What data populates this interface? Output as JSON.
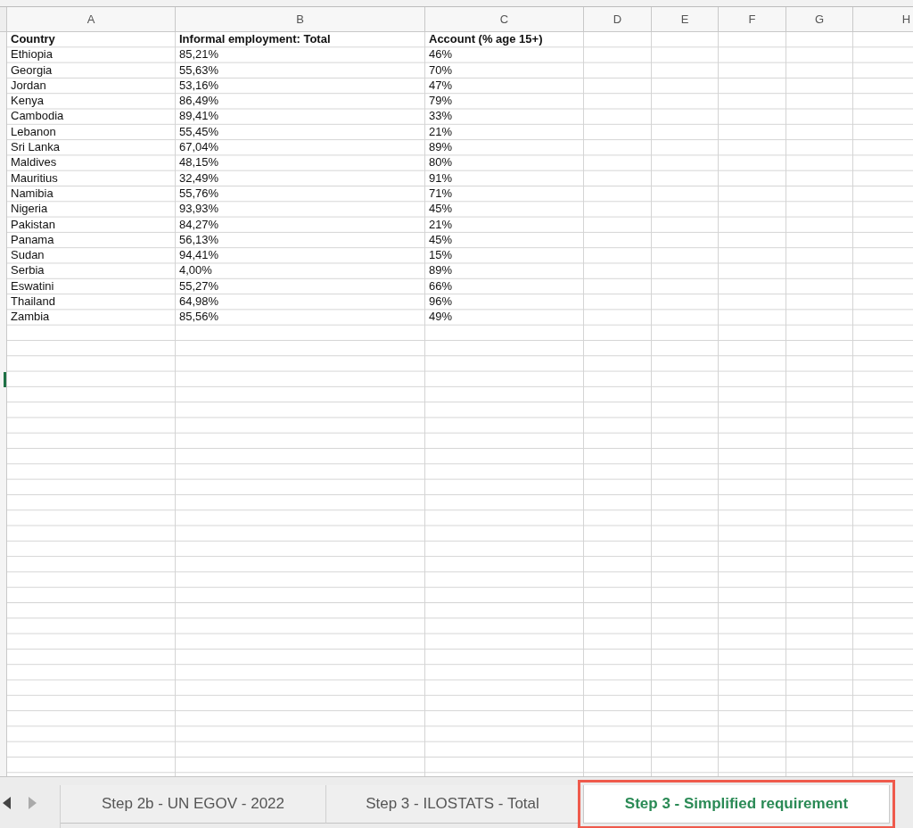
{
  "columns": [
    "A",
    "B",
    "C",
    "D",
    "E",
    "F",
    "G",
    "H"
  ],
  "header_row": [
    "Country",
    "Informal employment: Total",
    "Account (% age 15+)"
  ],
  "rows": [
    [
      "Ethiopia",
      "85,21%",
      "46%"
    ],
    [
      "Georgia",
      "55,63%",
      "70%"
    ],
    [
      "Jordan",
      "53,16%",
      "47%"
    ],
    [
      "Kenya",
      "86,49%",
      "79%"
    ],
    [
      "Cambodia",
      "89,41%",
      "33%"
    ],
    [
      "Lebanon",
      "55,45%",
      "21%"
    ],
    [
      "Sri Lanka",
      "67,04%",
      "89%"
    ],
    [
      "Maldives",
      "48,15%",
      "80%"
    ],
    [
      "Mauritius",
      "32,49%",
      "91%"
    ],
    [
      "Namibia",
      "55,76%",
      "71%"
    ],
    [
      "Nigeria",
      "93,93%",
      "45%"
    ],
    [
      "Pakistan",
      "84,27%",
      "21%"
    ],
    [
      "Panama",
      "56,13%",
      "45%"
    ],
    [
      "Sudan",
      "94,41%",
      "15%"
    ],
    [
      "Serbia",
      "4,00%",
      "89%"
    ],
    [
      "Eswatini",
      "55,27%",
      "66%"
    ],
    [
      "Thailand",
      "64,98%",
      "96%"
    ],
    [
      "Zambia",
      "85,56%",
      "49%"
    ]
  ],
  "sheet_tabs": [
    {
      "label": "Step 2b - UN EGOV - 2022",
      "selected": false,
      "highlighted": false
    },
    {
      "label": "Step 3 - ILOSTATS - Total",
      "selected": false,
      "highlighted": false
    },
    {
      "label": "Step 3 - Simplified requirement",
      "selected": true,
      "highlighted": true
    }
  ]
}
